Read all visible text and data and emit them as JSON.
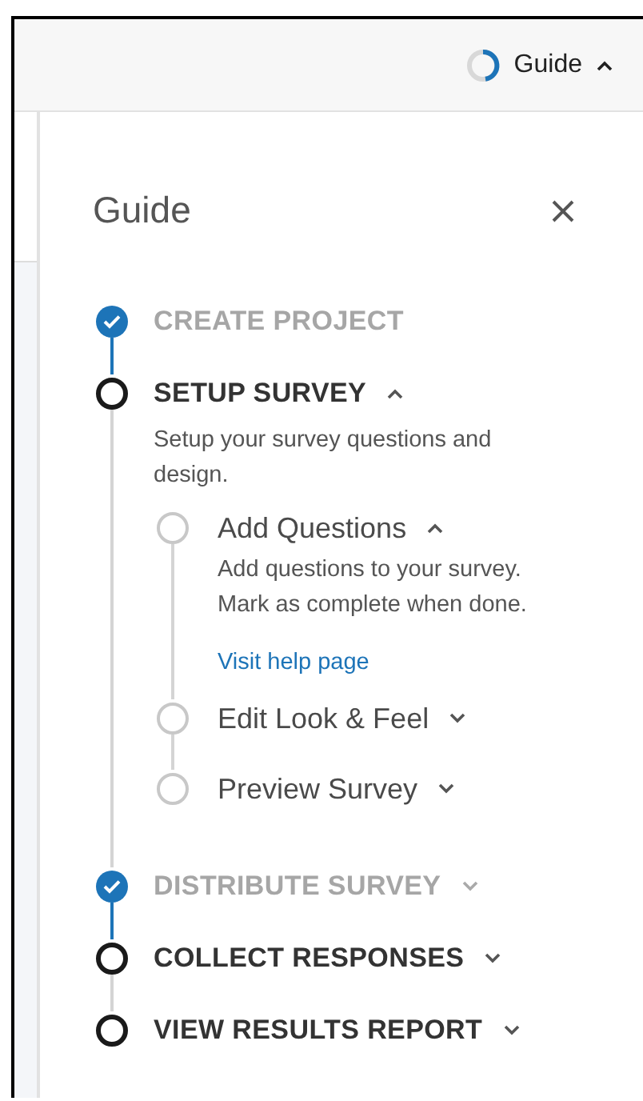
{
  "top_bar": {
    "guide_button": {
      "label": "Guide",
      "expanded": true
    }
  },
  "panel": {
    "title": "Guide"
  },
  "steps": [
    {
      "label": "CREATE PROJECT",
      "completed": true,
      "expanded": false,
      "chevron": false
    },
    {
      "label": "SETUP SURVEY",
      "completed": false,
      "expanded": true,
      "chevron": true,
      "description": "Setup your survey questions and design.",
      "substeps": [
        {
          "label": "Add Questions",
          "completed": false,
          "expanded": true,
          "description": "Add questions to your survey. Mark as complete when done.",
          "link": "Visit help page"
        },
        {
          "label": "Edit Look & Feel",
          "completed": false,
          "expanded": false
        },
        {
          "label": "Preview Survey",
          "completed": false,
          "expanded": false
        }
      ]
    },
    {
      "label": "DISTRIBUTE SURVEY",
      "completed": true,
      "expanded": false,
      "chevron": true
    },
    {
      "label": "COLLECT RESPONSES",
      "completed": false,
      "expanded": false,
      "chevron": true
    },
    {
      "label": "VIEW RESULTS REPORT",
      "completed": false,
      "expanded": false,
      "chevron": true
    }
  ]
}
